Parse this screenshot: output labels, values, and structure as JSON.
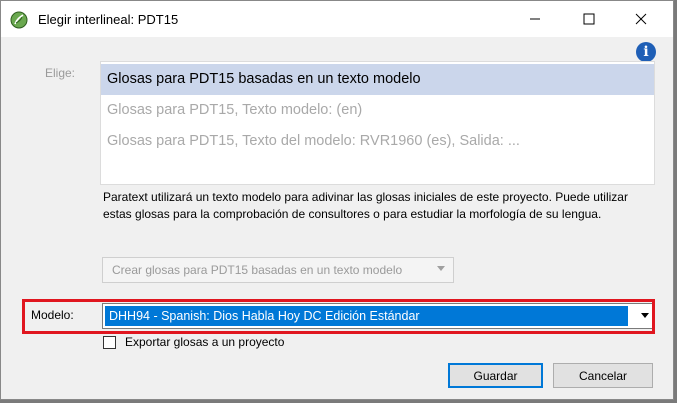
{
  "window": {
    "title": "Elegir interlineal: PDT15",
    "controls": [
      "minimize-icon",
      "maximize-icon",
      "close-icon"
    ]
  },
  "info_icon": {
    "glyph": "i",
    "color": "#1f5fb6"
  },
  "elige": {
    "label": "Elige:",
    "options": [
      {
        "label": "Glosas para PDT15 basadas en un texto modelo",
        "state": "selected"
      },
      {
        "label": "Glosas para PDT15, Texto modelo: (en)",
        "state": "disabled"
      },
      {
        "label": "Glosas para PDT15, Texto del modelo: RVR1960 (es), Salida: ...",
        "state": "disabled"
      }
    ]
  },
  "description": "Paratext utilizará un texto modelo para adivinar las glosas iniciales de este proyecto. Puede utilizar estas glosas para la comprobación de consultores o para estudiar la morfología de su lengua.",
  "create_button": {
    "label": "Crear glosas para PDT15 basadas en un texto modelo"
  },
  "modelo": {
    "label": "Modelo:",
    "selected_value": "DHH94 - Spanish: Dios Habla Hoy DC Edición Estándar",
    "highlight_color": "#e0161f"
  },
  "export_checkbox": {
    "label": "Exportar glosas a un proyecto",
    "checked": false
  },
  "buttons": {
    "save": "Guardar",
    "cancel": "Cancelar"
  },
  "colors": {
    "selection": "#0078d7",
    "list_selected": "#cbd6eb"
  }
}
